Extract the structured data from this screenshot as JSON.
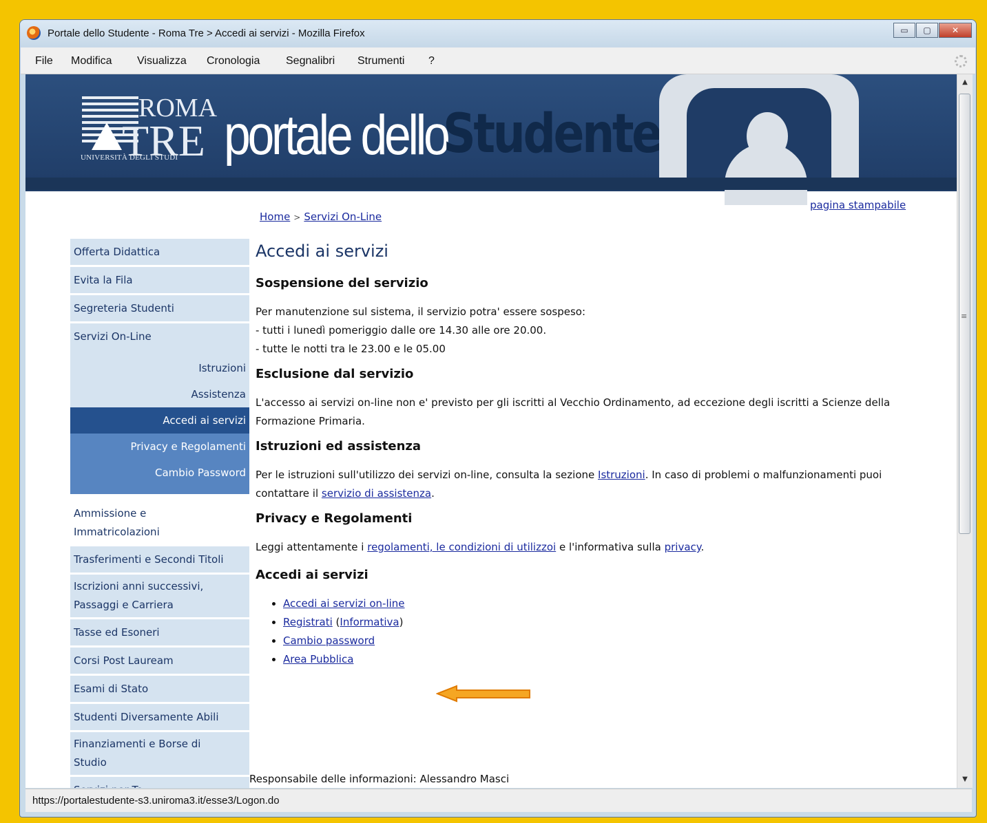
{
  "window": {
    "title": "Portale dello Studente - Roma Tre > Accedi ai servizi - Mozilla Firefox",
    "controls": [
      "minimize",
      "maximize",
      "close"
    ]
  },
  "menubar": [
    "File",
    "Modifica",
    "Visualizza",
    "Cronologia",
    "Segnalibri",
    "Strumenti",
    "?"
  ],
  "banner": {
    "roma": "ROMA",
    "tre": "TRE",
    "universita": "UNIVERSITÀ DEGLI STUDI",
    "portale": "portale dello",
    "studente": "Studente"
  },
  "breadcrumb": {
    "home": "Home",
    "separator": ">",
    "current": "Servizi On-Line"
  },
  "print_link": "pagina stampabile",
  "sidebar": {
    "items_top": [
      "Offerta Didattica",
      "Evita la Fila",
      "Segreteria Studenti",
      "Servizi On-Line"
    ],
    "sub_items": [
      "Istruzioni",
      "Assistenza"
    ],
    "active": "Accedi ai servizi",
    "blue_items": [
      "Privacy e Regolamenti",
      "Cambio Password"
    ],
    "items_bottom": [
      "Ammissione e Immatricolazioni",
      "Trasferimenti e Secondi Titoli",
      "Iscrizioni anni successivi, Passaggi e Carriera",
      "Tasse ed Esoneri",
      "Corsi Post Lauream",
      "Esami di Stato",
      "Studenti Diversamente Abili",
      "Finanziamenti e Borse di Studio",
      "Servizi per Te"
    ]
  },
  "main": {
    "title": "Accedi ai servizi",
    "sospensione": {
      "heading": "Sospensione del servizio",
      "lines": [
        "Per manutenzione sul sistema, il servizio potra' essere sospeso:",
        "- tutti i lunedì pomeriggio dalle ore 14.30 alle ore 20.00.",
        "- tutte le notti tra le 23.00 e le 05.00"
      ]
    },
    "esclusione": {
      "heading": "Esclusione dal servizio",
      "text": "L'accesso ai servizi on-line non e' previsto per gli iscritti al Vecchio Ordinamento, ad eccezione degli iscritti a Scienze della Formazione Primaria."
    },
    "istruzioni": {
      "heading": "Istruzioni ed assistenza",
      "t1": "Per le istruzioni sull'utilizzo dei servizi on-line, consulta la sezione ",
      "link1": "Istruzioni",
      "t2": ". In caso di problemi o malfunzionamenti puoi contattare il ",
      "link2": "servizio di assistenza",
      "t3": "."
    },
    "privacy": {
      "heading": "Privacy e Regolamenti",
      "t1": "Leggi attentamente i ",
      "link1": "regolamenti, le condizioni di utilizzoi",
      "t2": " e l'informativa sulla ",
      "link2": "privacy",
      "t3": "."
    },
    "accedi": {
      "heading": "Accedi ai servizi",
      "links": [
        "Accedi ai servizi on-line",
        "Registrati",
        "Cambio password",
        "Area Pubblica"
      ],
      "informativa_open": " (",
      "informativa": "Informativa",
      "informativa_close": ")"
    },
    "responsabile": "Responsabile delle informazioni: Alessandro Masci"
  },
  "status_url": "https://portalestudente-s3.uniroma3.it/esse3/Logon.do",
  "colors": {
    "frame": "#f4c400",
    "banner": "#1f3c66",
    "sidebar_bg": "#d5e3f0",
    "sidebar_active": "#25518e",
    "sidebar_blue": "#5785c1",
    "link": "#1a2a9e",
    "arrow": "#f5a623"
  }
}
